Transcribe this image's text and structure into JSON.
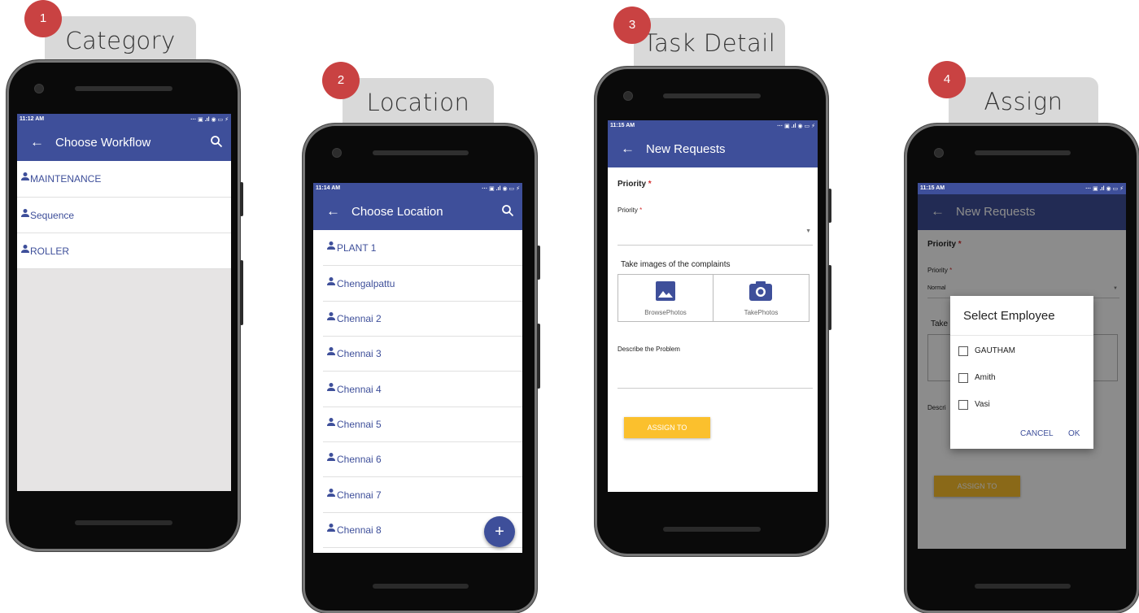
{
  "steps": [
    {
      "number": "1",
      "label": "Category"
    },
    {
      "number": "2",
      "label": "Location"
    },
    {
      "number": "3",
      "label": "Task Detail"
    },
    {
      "number": "4",
      "label": "Assign"
    }
  ],
  "screen1": {
    "time": "11:12 AM",
    "title": "Choose Workflow",
    "items": [
      "MAINTENANCE",
      "Sequence",
      "ROLLER"
    ]
  },
  "screen2": {
    "time": "11:14 AM",
    "title": "Choose Location",
    "items": [
      "PLANT 1",
      "Chengalpattu",
      "Chennai 2",
      "Chennai 3",
      "Chennai 4",
      "Chennai 5",
      "Chennai 6",
      "Chennai 7",
      "Chennai 8"
    ],
    "fab": "+"
  },
  "screen3": {
    "time": "11:15 AM",
    "title": "New Requests",
    "priority_heading": "Priority",
    "priority_label": "Priority",
    "required_mark": "*",
    "images_label": "Take images of the complaints",
    "browse_label": "BrowsePhotos",
    "take_label": "TakePhotos",
    "describe_label": "Describe the Problem",
    "assign_button": "ASSIGN TO"
  },
  "screen4": {
    "time": "11:15 AM",
    "title": "New Requests",
    "priority_heading": "Priority",
    "priority_label": "Priority",
    "required_mark": "*",
    "priority_value": "Normal",
    "take_partial": "Take",
    "describe_partial": "Descri",
    "assign_button": "ASSIGN TO",
    "dialog": {
      "title": "Select Employee",
      "employees": [
        "GAUTHAM",
        "Amith",
        "Vasi"
      ],
      "cancel": "CANCEL",
      "ok": "OK"
    }
  },
  "icons": {
    "back": "arrow-left-icon",
    "search": "search-icon",
    "person": "person-icon",
    "image": "image-icon",
    "camera": "camera-icon",
    "dropdown": "chevron-down-icon"
  },
  "colors": {
    "primary": "#3e4f9a",
    "accent": "#fbc02d",
    "badge": "#c94242",
    "required": "#d32f2f"
  }
}
